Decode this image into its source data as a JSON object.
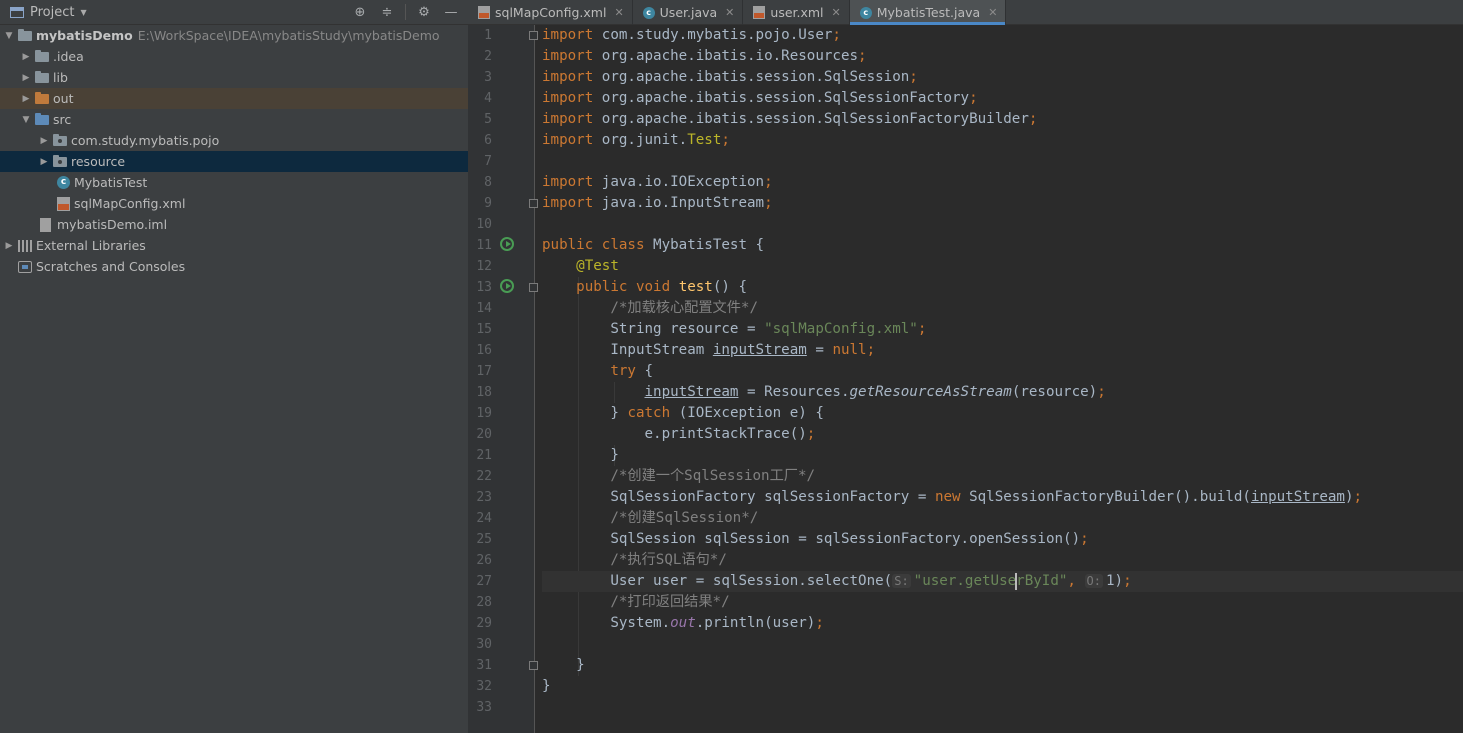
{
  "project_panel": {
    "title": "Project",
    "tree": [
      {
        "label": "mybatisDemo",
        "path": "E:\\WorkSpace\\IDEA\\mybatisStudy\\mybatisDemo",
        "kind": "module"
      },
      {
        "label": ".idea",
        "kind": "folder"
      },
      {
        "label": "lib",
        "kind": "folder"
      },
      {
        "label": "out",
        "kind": "folder-excluded"
      },
      {
        "label": "src",
        "kind": "source-folder"
      },
      {
        "label": "com.study.mybatis.pojo",
        "kind": "package"
      },
      {
        "label": "resource",
        "kind": "package"
      },
      {
        "label": "MybatisTest",
        "kind": "class"
      },
      {
        "label": "sqlMapConfig.xml",
        "kind": "xml"
      },
      {
        "label": "mybatisDemo.iml",
        "kind": "iml"
      },
      {
        "label": "External Libraries",
        "kind": "libraries"
      },
      {
        "label": "Scratches and Consoles",
        "kind": "scratches"
      }
    ]
  },
  "tabs": [
    {
      "label": "sqlMapConfig.xml",
      "icon": "xml-file-icon"
    },
    {
      "label": "User.java",
      "icon": "class-icon"
    },
    {
      "label": "user.xml",
      "icon": "xml-file-icon"
    },
    {
      "label": "MybatisTest.java",
      "icon": "class-icon",
      "active": true
    }
  ],
  "editor": {
    "line_numbers": [
      "1",
      "2",
      "3",
      "4",
      "5",
      "6",
      "7",
      "8",
      "9",
      "10",
      "11",
      "12",
      "13",
      "14",
      "15",
      "16",
      "17",
      "18",
      "19",
      "20",
      "21",
      "22",
      "23",
      "24",
      "25",
      "26",
      "27",
      "28",
      "29",
      "30",
      "31",
      "32",
      "33"
    ],
    "code": {
      "l1_kw": "import",
      "l1_rest": " com.study.mybatis.pojo.User",
      "l2_kw": "import",
      "l2_rest": " org.apache.ibatis.io.Resources",
      "l3_kw": "import",
      "l3_rest": " org.apache.ibatis.session.SqlSession",
      "l4_kw": "import",
      "l4_rest": " org.apache.ibatis.session.SqlSessionFactory",
      "l5_kw": "import",
      "l5_rest": " org.apache.ibatis.session.SqlSessionFactoryBuilder",
      "l6_kw": "import",
      "l6_rest": " org.junit.",
      "l6_ann": "Test",
      "l8_kw": "import",
      "l8_rest": " java.io.IOException",
      "l9_kw": "import",
      "l9_rest": " java.io.InputStream",
      "l11_kw": "public class",
      "l11_rest": " MybatisTest {",
      "l12_ann": "@Test",
      "l13_kw": "public void",
      "l13_fn": "test",
      "l13_rest": "() {",
      "l14_cmt": "/*加载核心配置文件*/",
      "l15_a": "String resource = ",
      "l15_str": "\"sqlMapConfig.xml\"",
      "l16_a": "InputStream ",
      "l16_ul": "inputStream",
      "l16_b": " = ",
      "l16_kw": "null",
      "l17_kw": "try",
      "l17_rest": " {",
      "l18_ul": "inputStream",
      "l18_a": " = Resources.",
      "l18_it": "getResourceAsStream",
      "l18_b": "(resource)",
      "l19_a": "} ",
      "l19_kw": "catch",
      "l19_b": " (IOException e) {",
      "l20_a": "e.printStackTrace()",
      "l21_a": "}",
      "l22_cmt": "/*创建一个SqlSession工厂*/",
      "l23_a": "SqlSessionFactory sqlSessionFactory = ",
      "l23_kw": "new",
      "l23_b": " SqlSessionFactoryBuilder().build(",
      "l23_ul": "inputStream",
      "l23_c": ")",
      "l24_cmt": "/*创建SqlSession*/",
      "l25_a": "SqlSession sqlSession = sqlSessionFactory.openSession()",
      "l26_cmt": "/*执行SQL语句*/",
      "l27_a": "User user = sqlSession.selectOne(",
      "l27_hint1": "S:",
      "l27_str1": "\"user.getUse",
      "l27_str2": "rById\"",
      "l27_b": ", ",
      "l27_hint2": "O:",
      "l27_c": "1)",
      "l28_cmt": "/*打印返回结果*/",
      "l29_a": "System.",
      "l29_it": "out",
      "l29_b": ".println(user)",
      "l31_a": "}",
      "l32_a": "}",
      "semicolon": ";",
      "comma": ","
    }
  },
  "colors": {
    "keyword": "#cc7832",
    "annotation": "#bbb529",
    "string": "#6a8759",
    "comment": "#808080",
    "method": "#ffc66d",
    "static_field": "#9876aa",
    "selection": "#0d293e",
    "active_tab_underline": "#4a88c7"
  }
}
